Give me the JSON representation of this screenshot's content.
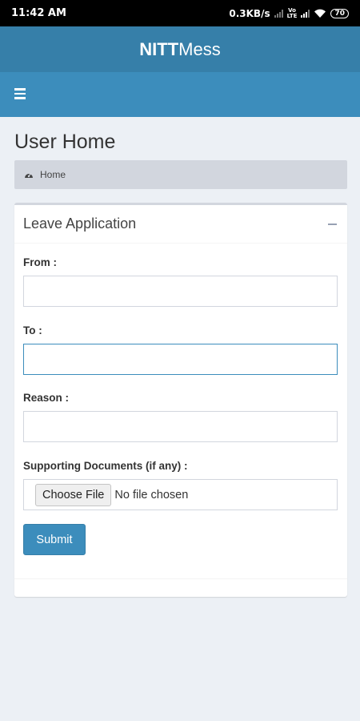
{
  "status_bar": {
    "time": "11:42 AM",
    "net_speed": "0.3KB/s",
    "network_label_top": "Vo",
    "network_label_bottom": "LTE",
    "battery": "70"
  },
  "brand": {
    "bold": "NITT",
    "light": "Mess"
  },
  "page": {
    "title": "User Home"
  },
  "breadcrumb": {
    "home": "Home"
  },
  "leave_box": {
    "title": "Leave Application",
    "from_label": "From :",
    "to_label": "To :",
    "reason_label": "Reason :",
    "docs_label": "Supporting Documents (if any) :",
    "choose_file": "Choose File",
    "no_file": "No file chosen",
    "submit": "Submit"
  },
  "icons": {
    "menu": "hamburger-icon",
    "breadcrumb": "dashboard-gauge-icon",
    "collapse": "minus-icon"
  },
  "colors": {
    "brand": "#367fa9",
    "navbar": "#3c8dbc",
    "background": "#ecf0f5",
    "button": "#3c8dbc"
  }
}
